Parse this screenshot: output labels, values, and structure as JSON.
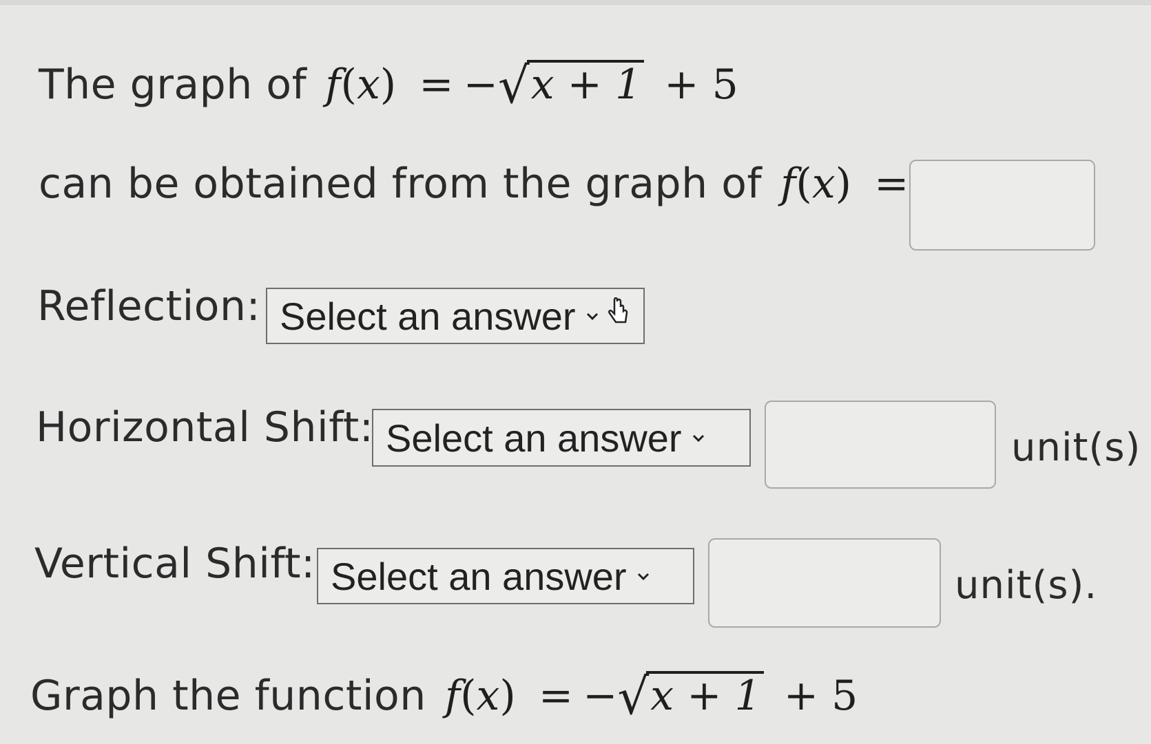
{
  "line1": {
    "prefix": "The graph of",
    "f": "f",
    "open": "(",
    "x": "x",
    "close": ")",
    "equals": "=",
    "minus": "−",
    "radical": "√",
    "radicand": "x + 1",
    "tail": "+ 5"
  },
  "line2": {
    "prefix": "can be obtained from the graph of",
    "f": "f",
    "open": "(",
    "x": "x",
    "close": ")",
    "equals": "="
  },
  "reflection": {
    "label": "Reflection:",
    "select_value": "Select an answer"
  },
  "horizontal": {
    "label": "Horizontal Shift:",
    "select_value": "Select an answer",
    "unit": "unit(s)"
  },
  "vertical": {
    "label": "Vertical Shift:",
    "select_value": "Select an answer",
    "unit": "unit(s)."
  },
  "graph_line": {
    "prefix": "Graph the function",
    "f": "f",
    "open": "(",
    "x": "x",
    "close": ")",
    "equals": "=",
    "minus": "−",
    "radical": "√",
    "radicand": "x + 1",
    "tail": "+ 5"
  },
  "icons": {
    "dropdown": "chevron-down-icon",
    "pointer": "hand-pointer-icon"
  }
}
